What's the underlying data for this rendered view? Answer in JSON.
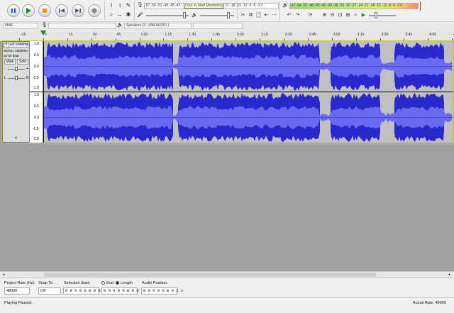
{
  "toolbar": {
    "transport": [
      "pause-button",
      "play-button",
      "stop-button",
      "skip-start-button",
      "skip-end-button",
      "record-button"
    ],
    "record_meter_scale": "-57 -54 -51 -48 -45 -42 -",
    "record_meter_prompt": "Click to Start Monitoring",
    "record_meter_scale2": "21 -18 -15 -12 -9 -6 -3 0",
    "playback_meter_scale": "-57 -54 -51 -48 -45 -42 -39 -36 -33 -30 -27 -24 -21 -18 -15 -12 -9 -6 -3 0",
    "mic_level_label": "",
    "speaker_level_label": ""
  },
  "device": {
    "host": "MME",
    "output": "Speakers (3- USB AUDIO )"
  },
  "ruler": {
    "ticks": [
      "-15",
      "0",
      "15",
      "30",
      "45",
      "1:00",
      "1:15",
      "1:30",
      "1:45",
      "2:00",
      "2:15",
      "2:30",
      "2:45",
      "3:00",
      "3:15",
      "3:30",
      "3:45",
      "4:00",
      "4:15"
    ]
  },
  "track": {
    "name": "Ed Sheeran",
    "info1": "Stereo, 48000Hz",
    "info2": "32-bit float",
    "mute_label": "Mute",
    "solo_label": "Solo",
    "scale_top": "1.0",
    "scale_mid_top": "0.5",
    "scale_zero": "0.0",
    "scale_mid_bot": "-0.5",
    "scale_bot": "-1.0",
    "gain_minus": "-",
    "gain_plus": "+",
    "pan_left": "L",
    "pan_right": "R",
    "wave_color": "#2828cc"
  },
  "selection": {
    "project_rate_label": "Project Rate (Hz):",
    "project_rate_value": "48000",
    "snap_label": "Snap To:",
    "snap_value": "Off",
    "sel_start_label": "Selection Start:",
    "end_label": "End",
    "length_label": "Length",
    "start_value": "0 0 h 0 0 m 0 0 s",
    "length_value": "0 0 h 0 0 m 0 0 s",
    "audio_pos_label": "Audio Position:",
    "audio_pos_value": "0 0 h 0 0 m 0 2 s"
  },
  "status": {
    "left": "Playing Paused.",
    "right": "Actual Rate: 48000"
  }
}
